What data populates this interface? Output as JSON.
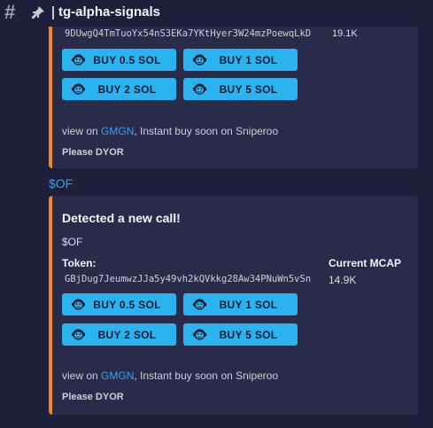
{
  "header": {
    "channel_name": "tg-alpha-signals"
  },
  "embed1": {
    "token_partial": "9DUwgQ4TmTuoYx54nS3EKa7YKtHyer3W24mzPoewqLkD",
    "mcap_partial": "19.1K",
    "buttons": [
      "BUY 0.5 SOL",
      "BUY 1 SOL",
      "BUY 2 SOL",
      "BUY 5 SOL"
    ],
    "view_prefix": "view on ",
    "view_link": "GMGN",
    "view_suffix": ", Instant buy soon on Sniperoo",
    "dyor": "Please DYOR"
  },
  "message2": {
    "text": "$OF"
  },
  "embed2": {
    "title": "Detected a new call!",
    "ticker": "$OF",
    "token_label": "Token:",
    "token_address": "GBjDug7JeumwzJJa5y49vh2kQVkkg28Aw34PNuWn5vSn",
    "mcap_label": "Current MCAP",
    "mcap_value": "14.9K",
    "buttons": [
      "BUY 0.5 SOL",
      "BUY 1 SOL",
      "BUY 2 SOL",
      "BUY 5 SOL"
    ],
    "view_prefix": "view on ",
    "view_link": "GMGN",
    "view_suffix": ", Instant buy soon on Sniperoo",
    "dyor": "Please DYOR"
  },
  "colors": {
    "accent_bar": "#ea8a25",
    "button": "#2ab3ee",
    "link": "#3aa1f2",
    "embed_bg": "#2a2b4a",
    "page_bg": "#1e1f3a"
  }
}
